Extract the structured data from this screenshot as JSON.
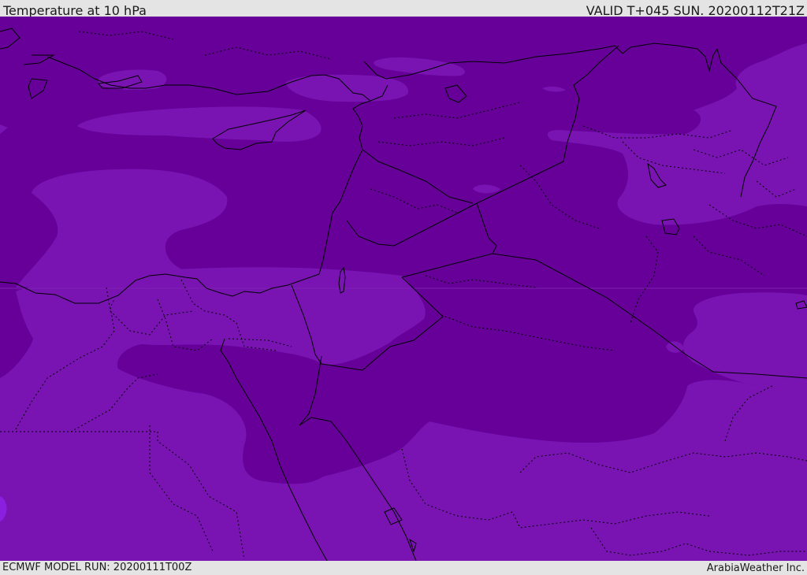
{
  "header": {
    "title": "Temperature at 10 hPa",
    "valid": "VALID T+045 SUN. 20200112T21Z"
  },
  "footer": {
    "model_run": "ECMWF MODEL RUN: 20200111T00Z",
    "credit": "ArabiaWeather Inc."
  },
  "colors": {
    "dark_purple": "#660099",
    "light_purple": "#7914b3",
    "violet_spot": "#8a1fe0",
    "coastline": "#000000",
    "border": "#000000",
    "bar_background": "#e4e4e4"
  }
}
